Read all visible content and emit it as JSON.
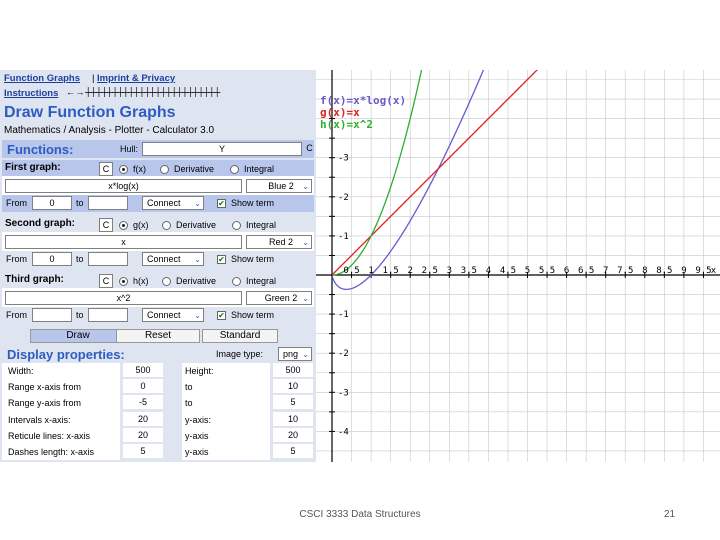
{
  "nav": {
    "function_graphs": "Function Graphs",
    "separator": "|",
    "imprint": "Imprint & Privacy",
    "instructions": "Instructions",
    "scale_glyphs": "← → ┼┼┼┼┼┼┼┼┼┼┼┼┼┼┼┼┼┼┼┼┼┼┼┼┼"
  },
  "header": {
    "title": "Draw Function Graphs",
    "subtitle": "Mathematics / Analysis - Plotter - Calculator 3.0"
  },
  "functions": {
    "heading": "Functions:",
    "hull_label": "Hull:",
    "hull_value": "Y",
    "hull_btn": "C"
  },
  "graphs": [
    {
      "title": "First graph:",
      "clear": "C",
      "name_opt": "f(x)",
      "deriv_opt": "Derivative",
      "integral_opt": "Integral",
      "expr": "x*log(x)",
      "color": "Blue 2",
      "from_label": "From",
      "from_val": "0",
      "to_label": "to",
      "to_val": "",
      "connect": "Connect",
      "show_term": "Show term"
    },
    {
      "title": "Second graph:",
      "clear": "C",
      "name_opt": "g(x)",
      "deriv_opt": "Derivative",
      "integral_opt": "Integral",
      "expr": "x",
      "color": "Red 2",
      "from_label": "From",
      "from_val": "0",
      "to_label": "to",
      "to_val": "",
      "connect": "Connect",
      "show_term": "Show term"
    },
    {
      "title": "Third graph:",
      "clear": "C",
      "name_opt": "h(x)",
      "deriv_opt": "Derivative",
      "integral_opt": "Integral",
      "expr": "x^2",
      "color": "Green 2",
      "from_label": "From",
      "from_val": "",
      "to_label": "to",
      "to_val": "",
      "connect": "Connect",
      "show_term": "Show term"
    }
  ],
  "buttons": {
    "draw": "Draw",
    "reset": "Reset",
    "standard": "Standard"
  },
  "display": {
    "heading": "Display properties:",
    "image_type_label": "Image type:",
    "image_type": "png",
    "rows": [
      {
        "label": "Width:",
        "val1": "500",
        "label2": "Height:",
        "val2": "500"
      },
      {
        "label": "Range x-axis from",
        "val1": "0",
        "label2": "to",
        "val2": "10"
      },
      {
        "label": "Range y-axis from",
        "val1": "-5",
        "label2": "to",
        "val2": "5"
      },
      {
        "label": "Intervals x-axis:",
        "val1": "20",
        "label2": "y-axis:",
        "val2": "10"
      },
      {
        "label": "Reticule lines: x-axis",
        "val1": "20",
        "label2": "y-axis",
        "val2": "20"
      },
      {
        "label": "Dashes length: x-axis",
        "val1": "5",
        "label2": "y-axis",
        "val2": "5"
      }
    ]
  },
  "chart_data": {
    "type": "line",
    "xlim": [
      0,
      10
    ],
    "ylim": [
      -5,
      5
    ],
    "x_tick_labels": [
      "0.5",
      "1",
      "1.5",
      "2",
      "2.5",
      "3",
      "3.5",
      "4",
      "4.5",
      "5",
      "5.5",
      "6",
      "6.5",
      "7",
      "7.5",
      "8",
      "8.5",
      "9",
      "9.5"
    ],
    "x_axis_label": "x",
    "y_tick_labels": [
      "3",
      "2",
      "1",
      "-1",
      "-2",
      "-3",
      "-4"
    ],
    "grid": true,
    "legend_position": "top-left",
    "series": [
      {
        "name": "f(x)=x*log(x)",
        "color": "#6a5acd",
        "fn": "f"
      },
      {
        "name": "g(x)=x",
        "color": "#e02020",
        "fn": "g"
      },
      {
        "name": "h(x)=x^2",
        "color": "#2fae2f",
        "fn": "h"
      }
    ]
  },
  "footer": {
    "course": "CSCI 3333 Data Structures",
    "page": "21"
  }
}
